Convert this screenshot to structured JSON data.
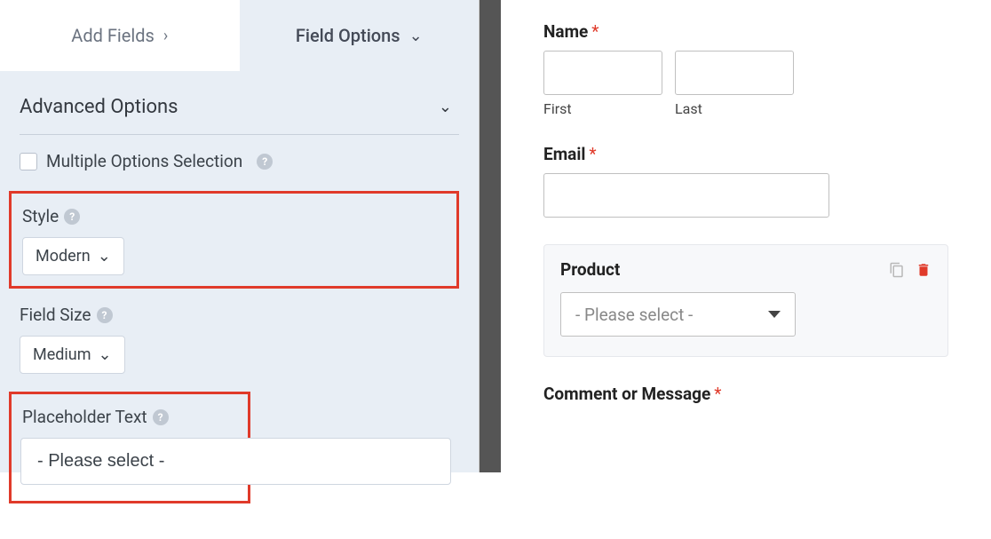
{
  "tabs": {
    "add_fields": "Add Fields",
    "field_options": "Field Options"
  },
  "advanced": {
    "title": "Advanced Options",
    "multiple_options": "Multiple Options Selection",
    "style_label": "Style",
    "style_value": "Modern",
    "field_size_label": "Field Size",
    "field_size_value": "Medium",
    "placeholder_label": "Placeholder Text",
    "placeholder_value": "- Please select -"
  },
  "preview": {
    "name_label": "Name",
    "first_sublabel": "First",
    "last_sublabel": "Last",
    "email_label": "Email",
    "product_label": "Product",
    "product_placeholder": "- Please select -",
    "comment_label": "Comment or Message"
  }
}
